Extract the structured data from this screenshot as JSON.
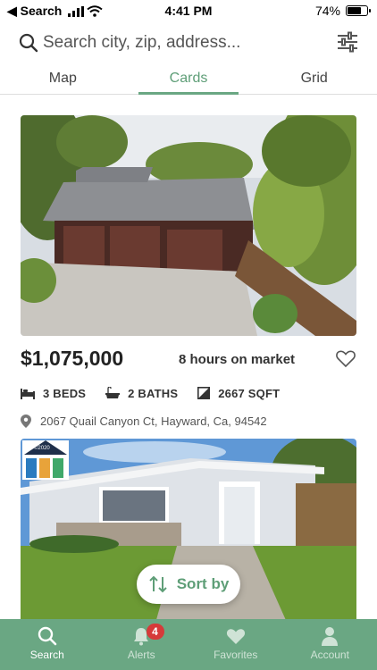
{
  "status_bar": {
    "back_label": "◀ Search",
    "time": "4:41 PM",
    "battery_text": "74%",
    "battery_level": 0.74
  },
  "search": {
    "placeholder": "Search city, zip, address..."
  },
  "tabs": [
    {
      "label": "Map",
      "active": false
    },
    {
      "label": "Cards",
      "active": true
    },
    {
      "label": "Grid",
      "active": false
    }
  ],
  "listing": {
    "price": "$1,075,000",
    "market_time": "8 hours on market",
    "beds": "3 BEDS",
    "baths": "2 BATHS",
    "sqft": "2667 SQFT",
    "address": "2067 Quail Canyon Ct, Hayward, Ca, 94542"
  },
  "logo_badge_text": "©2020",
  "sort_button": {
    "label": "Sort by"
  },
  "bottom_nav": [
    {
      "label": "Search",
      "icon": "search-icon",
      "active": true
    },
    {
      "label": "Alerts",
      "icon": "bell-icon",
      "active": false,
      "badge": "4"
    },
    {
      "label": "Favorites",
      "icon": "heart-icon",
      "active": false
    },
    {
      "label": "Account",
      "icon": "person-icon",
      "active": false
    }
  ],
  "colors": {
    "accent": "#6aa783",
    "accent_text": "#5e9e77",
    "badge": "#d63a3a"
  }
}
